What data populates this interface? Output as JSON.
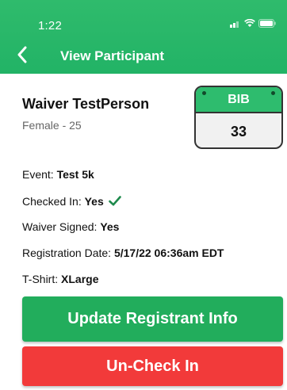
{
  "status_bar": {
    "time": "1:22",
    "icons": [
      "signal-icon",
      "wifi-icon",
      "battery-icon"
    ]
  },
  "header": {
    "title": "View Participant",
    "back_icon": "chevron-left-icon"
  },
  "participant": {
    "name": "Waiver TestPerson",
    "subtitle": "Female - 25"
  },
  "bib": {
    "label": "BIB",
    "number": "33"
  },
  "details": {
    "event_label": "Event:",
    "event_value": "Test 5k",
    "checked_in_label": "Checked In:",
    "checked_in_value": "Yes",
    "waiver_label": "Waiver Signed:",
    "waiver_value": "Yes",
    "registration_label": "Registration Date:",
    "registration_value": "5/17/22 06:36am EDT",
    "tshirt_label": "T-Shirt:",
    "tshirt_value": "XLarge"
  },
  "actions": {
    "update_label": "Update Registrant Info",
    "uncheck_label": "Un-Check In"
  },
  "colors": {
    "brand_green": "#22b366",
    "danger_red": "#f23a3a",
    "check_green": "#1e8a4c"
  }
}
